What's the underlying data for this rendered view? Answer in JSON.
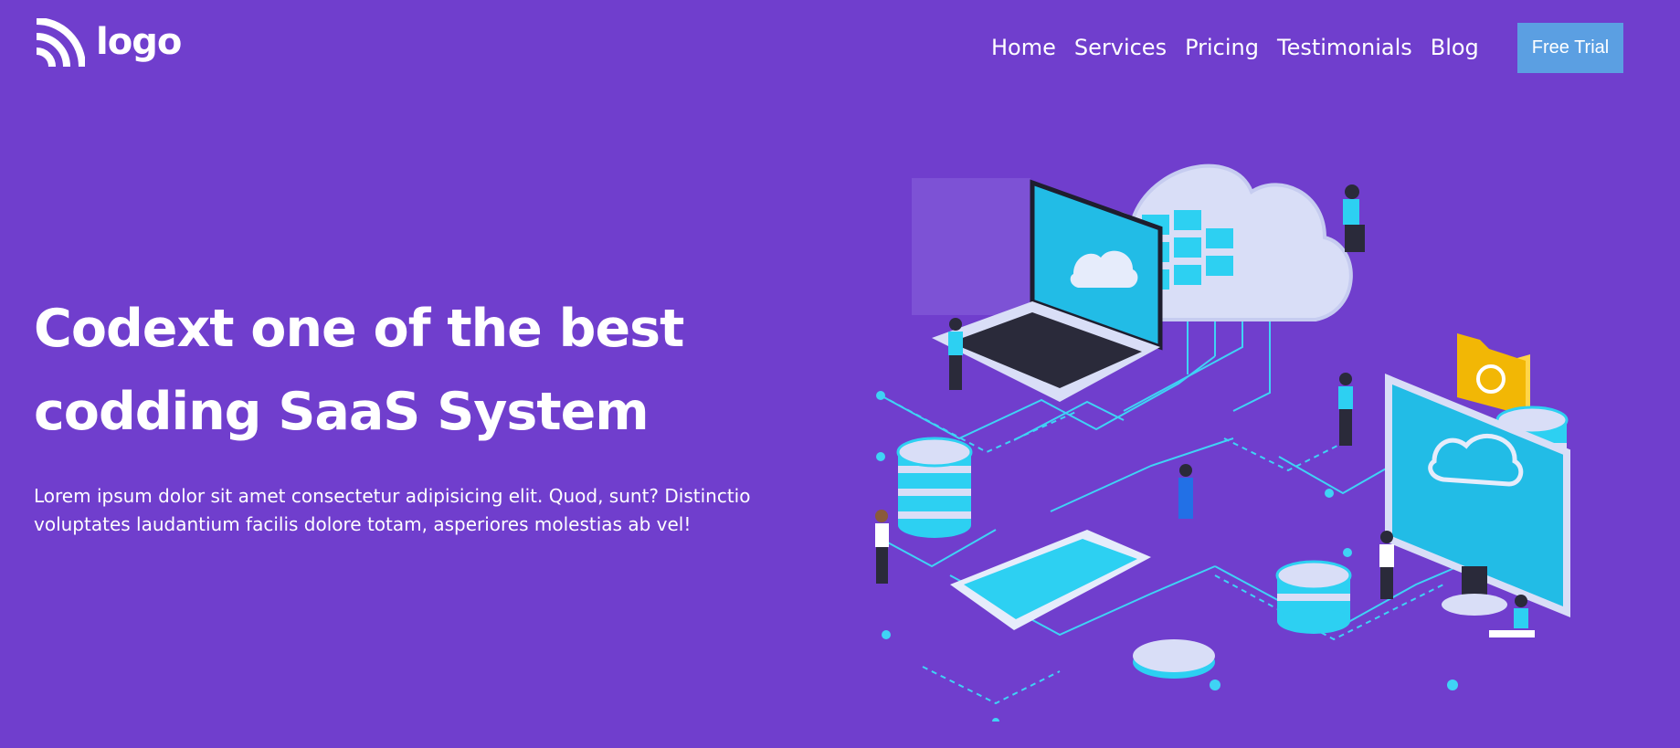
{
  "header": {
    "logo_text": "logo",
    "nav": [
      "Home",
      "Services",
      "Pricing",
      "Testimonials",
      "Blog"
    ],
    "cta_label": "Free Trial"
  },
  "hero": {
    "title_line1": "Codext one of the best",
    "title_line2": "codding SaaS System",
    "description": "Lorem ipsum dolor sit amet consectetur adipisicing elit. Quod, sunt? Distinctio voluptates laudantium facilis dolore totam, asperiores molestias ab vel!"
  },
  "colors": {
    "background": "#703ECD",
    "cta": "#5B9FE2",
    "accent": "#2DD0F2",
    "text": "#FFFFFF"
  },
  "illustration": {
    "icons": [
      "cloud-icon",
      "laptop-icon",
      "database-icon",
      "folder-icon",
      "monitor-icon",
      "smartphone-icon",
      "person-icon"
    ]
  }
}
